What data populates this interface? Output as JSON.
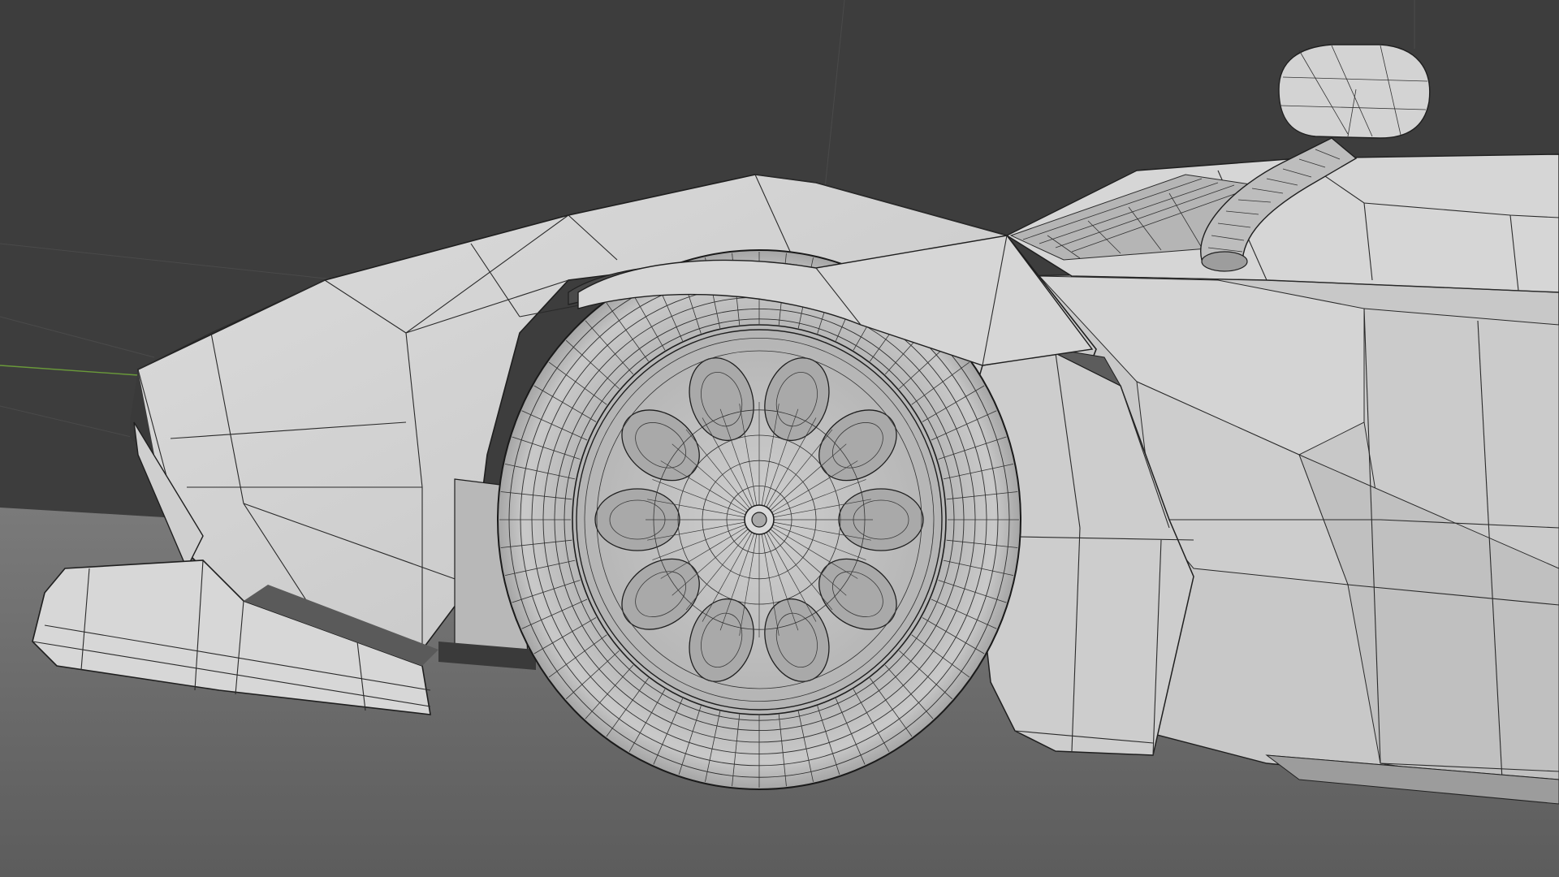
{
  "viewport": {
    "kind": "3d-viewport",
    "shading": "solid",
    "overlay": "wireframe",
    "subject": "car-front-wheel-mesh"
  },
  "colors": {
    "background": "#3d3d3d",
    "floor": "#6e6e6e",
    "body_light": "#d2d2d2",
    "body_mid": "#b9b9b9",
    "body_dark": "#8f8f8f",
    "wire": "#2a2a2a",
    "axis_y": "#6a9a3a"
  }
}
